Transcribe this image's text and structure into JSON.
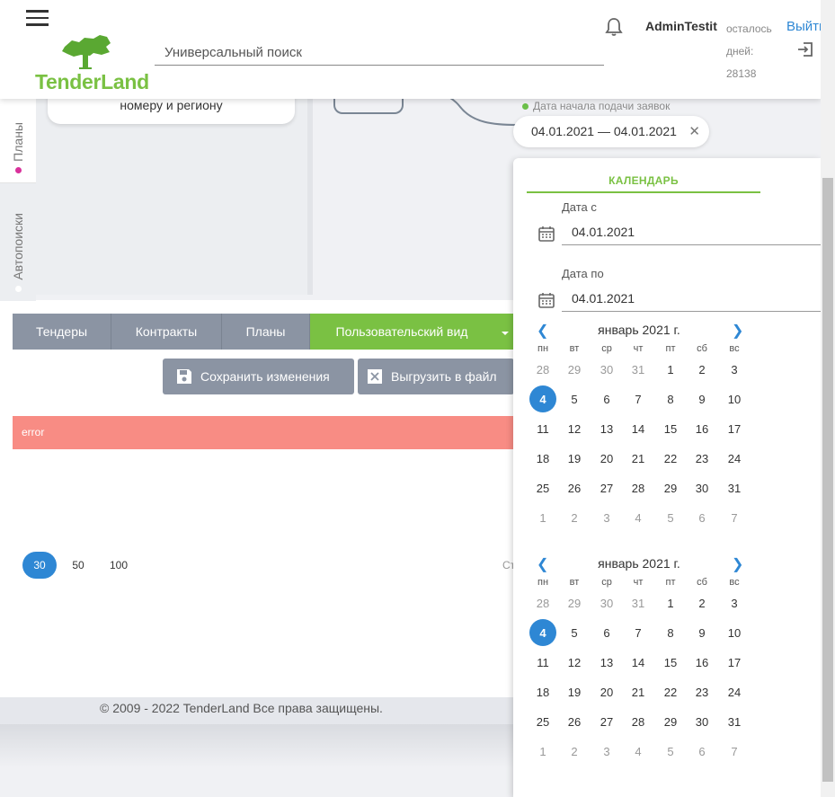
{
  "header": {
    "logo_text": "TenderLand",
    "search_placeholder": "Универсальный поиск",
    "username": "AdminTestit",
    "days_left": [
      "осталось",
      "дней:",
      "28138"
    ],
    "logout_label": "Выйти"
  },
  "side_tabs": [
    {
      "label": "Планы",
      "dot_color": "#d9319b"
    },
    {
      "label": "Автопоиски",
      "dot_color": "#ffffff"
    }
  ],
  "filter": {
    "card_text": "номеру и региону",
    "date_label": "Дата начала подачи заявок",
    "date_range": "04.01.2021 — 04.01.2021"
  },
  "tabs": [
    {
      "label": "Тендеры"
    },
    {
      "label": "Контракты"
    },
    {
      "label": "Планы"
    },
    {
      "label": "Пользовательский вид"
    }
  ],
  "buttons": {
    "save": "Сохранить изменения",
    "export": "Выгрузить в файл"
  },
  "error_text": "error",
  "page_sizes": [
    "30",
    "50",
    "100"
  ],
  "page_label_stub": "Ст",
  "footer": "© 2009 - 2022 TenderLand Все права защищены.",
  "calendar": {
    "header": "КАЛЕНДАРЬ",
    "from_label": "Дата с",
    "from_value": "04.01.2021",
    "to_label": "Дата по",
    "to_value": "04.01.2021",
    "weekdays": [
      "пн",
      "вт",
      "ср",
      "чт",
      "пт",
      "сб",
      "вс"
    ],
    "months": [
      {
        "title": "январь 2021 г.",
        "weeks": [
          [
            "28",
            "29",
            "30",
            "31",
            "1",
            "2",
            "3"
          ],
          [
            "4",
            "5",
            "6",
            "7",
            "8",
            "9",
            "10"
          ],
          [
            "11",
            "12",
            "13",
            "14",
            "15",
            "16",
            "17"
          ],
          [
            "18",
            "19",
            "20",
            "21",
            "22",
            "23",
            "24"
          ],
          [
            "25",
            "26",
            "27",
            "28",
            "29",
            "30",
            "31"
          ],
          [
            "1",
            "2",
            "3",
            "4",
            "5",
            "6",
            "7"
          ]
        ],
        "selected": "4"
      },
      {
        "title": "январь 2021 г.",
        "weeks": [
          [
            "28",
            "29",
            "30",
            "31",
            "1",
            "2",
            "3"
          ],
          [
            "4",
            "5",
            "6",
            "7",
            "8",
            "9",
            "10"
          ],
          [
            "11",
            "12",
            "13",
            "14",
            "15",
            "16",
            "17"
          ],
          [
            "18",
            "19",
            "20",
            "21",
            "22",
            "23",
            "24"
          ],
          [
            "25",
            "26",
            "27",
            "28",
            "29",
            "30",
            "31"
          ],
          [
            "1",
            "2",
            "3",
            "4",
            "5",
            "6",
            "7"
          ]
        ],
        "selected": "4"
      }
    ]
  },
  "colors": {
    "brand_green": "#7ac143",
    "accent_blue": "#2e87d4",
    "error": "#f88c84",
    "tab_grey": "#8b94a3"
  }
}
